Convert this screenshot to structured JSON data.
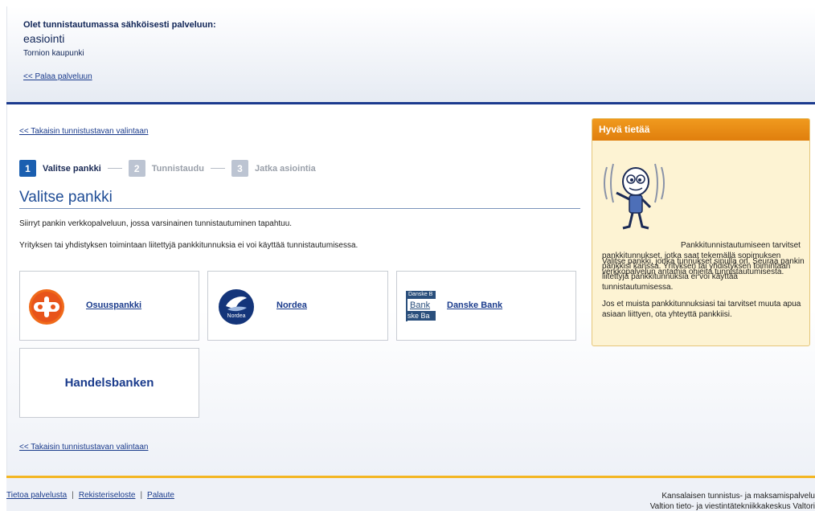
{
  "header": {
    "intro": "Olet tunnistautumassa sähköisesti palveluun:",
    "service": "easiointi",
    "organization": "Tornion kaupunki",
    "back_link": "<< Palaa palveluun"
  },
  "main": {
    "back_link_top": "<< Takaisin tunnistustavan valintaan",
    "back_link_bottom": "<< Takaisin tunnistustavan valintaan",
    "steps": [
      {
        "number": "1",
        "label": "Valitse pankki",
        "state": "active"
      },
      {
        "number": "2",
        "label": "Tunnistaudu",
        "state": "inactive"
      },
      {
        "number": "3",
        "label": "Jatka asiointia",
        "state": "inactive"
      }
    ],
    "title": "Valitse pankki",
    "para1": "Siirryt pankin verkkopalveluun, jossa varsinainen tunnistautuminen tapahtuu.",
    "para2": "Yrityksen tai yhdistyksen toimintaan liitettyjä pankkitunnuksia ei voi käyttää tunnistautumisessa.",
    "banks": {
      "op": "Osuuspankki",
      "nordea": "Nordea",
      "nordea_logo_text": "Nordea",
      "danske": "Danske Bank",
      "danske_logo_top": "Danske B",
      "danske_logo_mid": "Bank",
      "danske_logo_bottom": "ske Ba",
      "handelsbanken": "Handelsbanken"
    }
  },
  "info": {
    "title": "Hyvä tietää",
    "p1": "Pankkitunnistautumiseen tarvitset pankkitunnukset, jotka saat tekemällä sopimuksen pankkisi kanssa. Yrityksen tai yhdistyksen toimintaan liitettyjä pankkitunnuksia ei voi käyttää tunnistautumisessa.",
    "p2": "Valitse pankki, jonka tunnukset sinulla on. Seuraa pankin verkkopalvelun antamia ohjeita tunnistautumisesta.",
    "p3": "Jos et muista pankkitunnuksiasi tai tarvitset muuta apua asiaan liittyen, ota yhteyttä pankkiisi."
  },
  "footer": {
    "links": [
      "Tietoa palvelusta",
      "Rekisteriseloste",
      "Palaute"
    ],
    "separator": "|",
    "right_line1": "Kansalaisen tunnistus- ja maksamispalvelu",
    "right_line2": "Valtion tieto- ja viestintätekniikkakeskus Valtori"
  },
  "colors": {
    "brand_blue": "#1b3a8e",
    "accent_orange": "#e88a14",
    "footer_yellow": "#f3b622"
  }
}
